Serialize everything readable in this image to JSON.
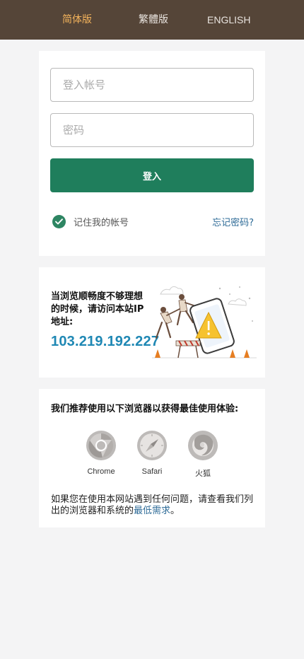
{
  "header": {
    "lang_simplified": "简体版",
    "lang_traditional": "繁體版",
    "lang_english": "ENGLISH"
  },
  "login": {
    "account_placeholder": "登入帐号",
    "password_placeholder": "密码",
    "login_button": "登入",
    "remember_label": "记住我的帐号",
    "remember_checked": true,
    "forgot_link": "忘记密码?"
  },
  "ip_notice": {
    "text": "当浏览顺畅度不够理想的时候，请访问本站IP地址:",
    "ip": "103.219.192.227"
  },
  "browsers": {
    "title": "我们推荐使用以下浏览器以获得最佳使用体验:",
    "items": [
      {
        "label": "Chrome",
        "icon": "chrome-icon"
      },
      {
        "label": "Safari",
        "icon": "safari-icon"
      },
      {
        "label": "火狐",
        "icon": "firefox-icon"
      }
    ],
    "help_text": "如果您在使用本网站遇到任何问题，请查看我们列出的浏览器和系统的",
    "help_link": "最低需求",
    "help_end": "。"
  },
  "colors": {
    "header_bg": "#554538",
    "active_lang": "#f3b35c",
    "primary": "#1f7e5c",
    "link": "#2e6b97",
    "ip": "#1f88b4"
  }
}
